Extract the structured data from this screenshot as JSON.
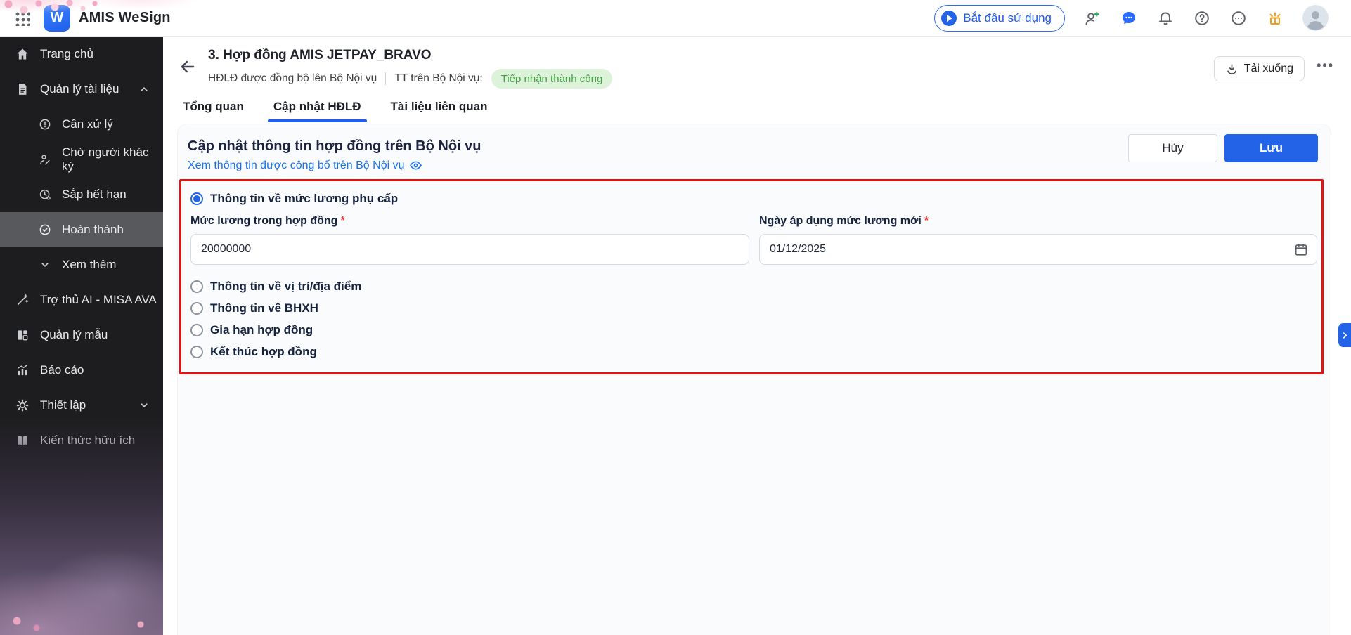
{
  "app": {
    "name": "AMIS WeSign"
  },
  "topbar": {
    "start_button_label": "Bắt đầu sử dụng"
  },
  "sidebar": {
    "items": [
      {
        "label": "Trang chủ"
      },
      {
        "label": "Quản lý tài liệu"
      },
      {
        "label": "Cần xử lý"
      },
      {
        "label": "Chờ người khác ký"
      },
      {
        "label": "Sắp hết hạn"
      },
      {
        "label": "Hoàn thành"
      },
      {
        "label": "Xem thêm"
      },
      {
        "label": "Trợ thủ AI - MISA AVA"
      },
      {
        "label": "Quản lý mẫu"
      },
      {
        "label": "Báo cáo"
      },
      {
        "label": "Thiết lập"
      },
      {
        "label": "Kiến thức hữu ích"
      }
    ]
  },
  "page": {
    "title": "3. Hợp đồng AMIS JETPAY_BRAVO",
    "sync_status": "HĐLĐ được đồng bộ lên Bộ Nội vụ",
    "ministry_status_label": "TT trên Bộ Nội vụ:",
    "ministry_status_value": "Tiếp nhận thành công",
    "download_button_label": "Tải xuống",
    "tabs": [
      {
        "label": "Tổng quan",
        "active": false
      },
      {
        "label": "Cập nhật HĐLĐ",
        "active": true
      },
      {
        "label": "Tài liệu liên quan",
        "active": false
      }
    ]
  },
  "card": {
    "title": "Cập nhật thông tin hợp đồng trên Bộ Nội vụ",
    "view_link": "Xem thông tin được công bố trên Bộ Nội vụ",
    "cancel_label": "Hủy",
    "save_label": "Lưu",
    "form": {
      "options": [
        {
          "label": "Thông tin về mức lương phụ cấp",
          "selected": true
        },
        {
          "label": "Thông tin về vị trí/địa điểm",
          "selected": false
        },
        {
          "label": "Thông tin về BHXH",
          "selected": false
        },
        {
          "label": "Gia hạn hợp đồng",
          "selected": false
        },
        {
          "label": "Kết thúc hợp đồng",
          "selected": false
        }
      ],
      "salary_field": {
        "label": "Mức lương trong hợp đồng",
        "required": "*",
        "value": "20000000"
      },
      "date_field": {
        "label": "Ngày áp dụng mức lương mới",
        "required": "*",
        "value": "01/12/2025"
      }
    }
  },
  "colors": {
    "accent_blue": "#2263e7",
    "link_blue": "#1a73e8",
    "badge_green_bg": "#dcf3d9",
    "badge_green_text": "#43a047",
    "highlight_red": "#e11212",
    "sidebar_bg": "#1d1d1f",
    "sidebar_active_bg": "#58595c"
  }
}
